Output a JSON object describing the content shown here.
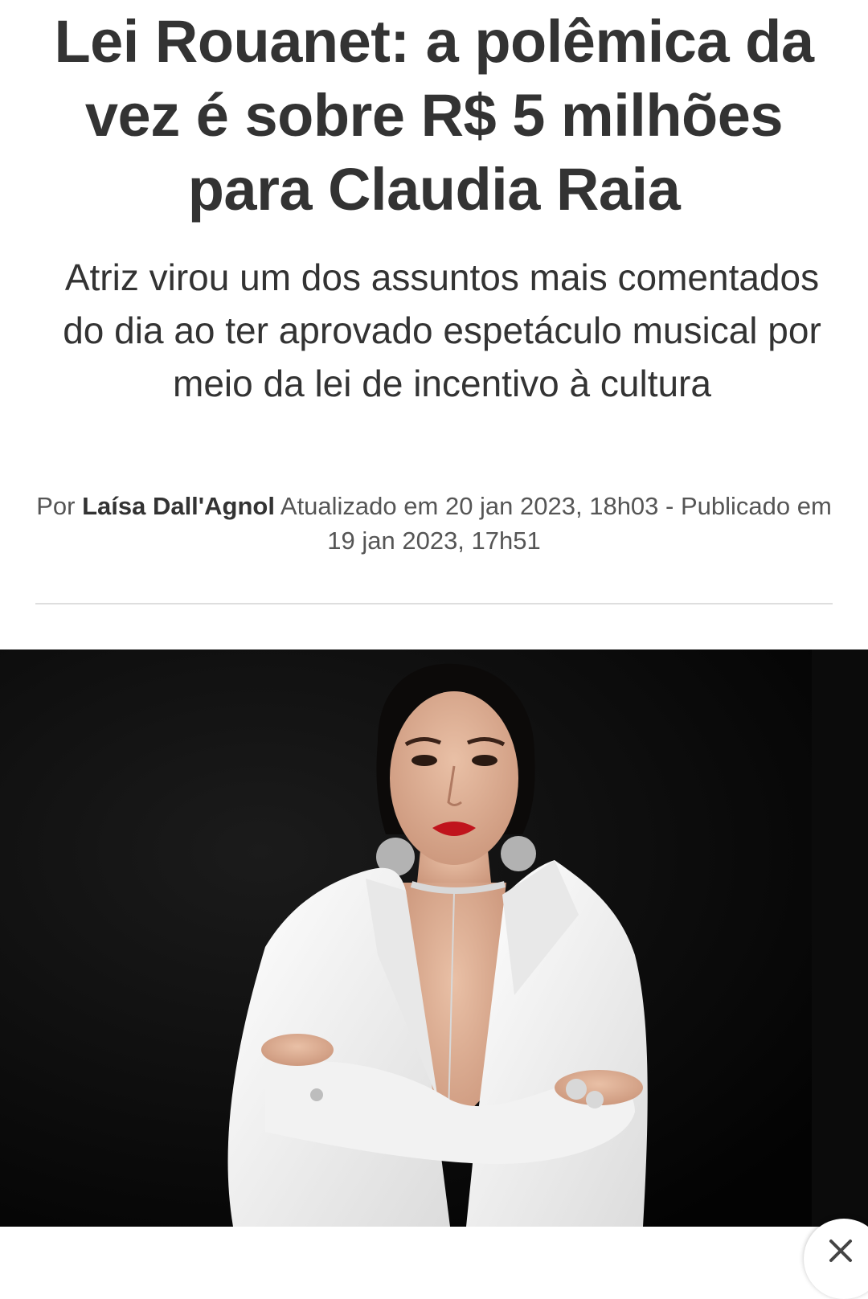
{
  "article": {
    "headline": "Lei Rouanet: a polêmica da vez é sobre R$ 5 milhões para Claudia Raia",
    "subheadline": "Atriz virou um dos assuntos mais comentados do dia ao ter aprovado espetáculo musical por meio da lei de incentivo à cultura",
    "byline": {
      "prefix": "Por",
      "author": "Laísa Dall'Agnol",
      "dates": "Atualizado em 20 jan 2023, 18h03 - Publicado em 19 jan 2023, 17h51"
    }
  },
  "photo": {
    "background_color": "#070707",
    "outfit_color": "#f4f4f4",
    "lip_color": "#c0141c"
  },
  "overlay": {
    "close_icon": "close-icon"
  }
}
